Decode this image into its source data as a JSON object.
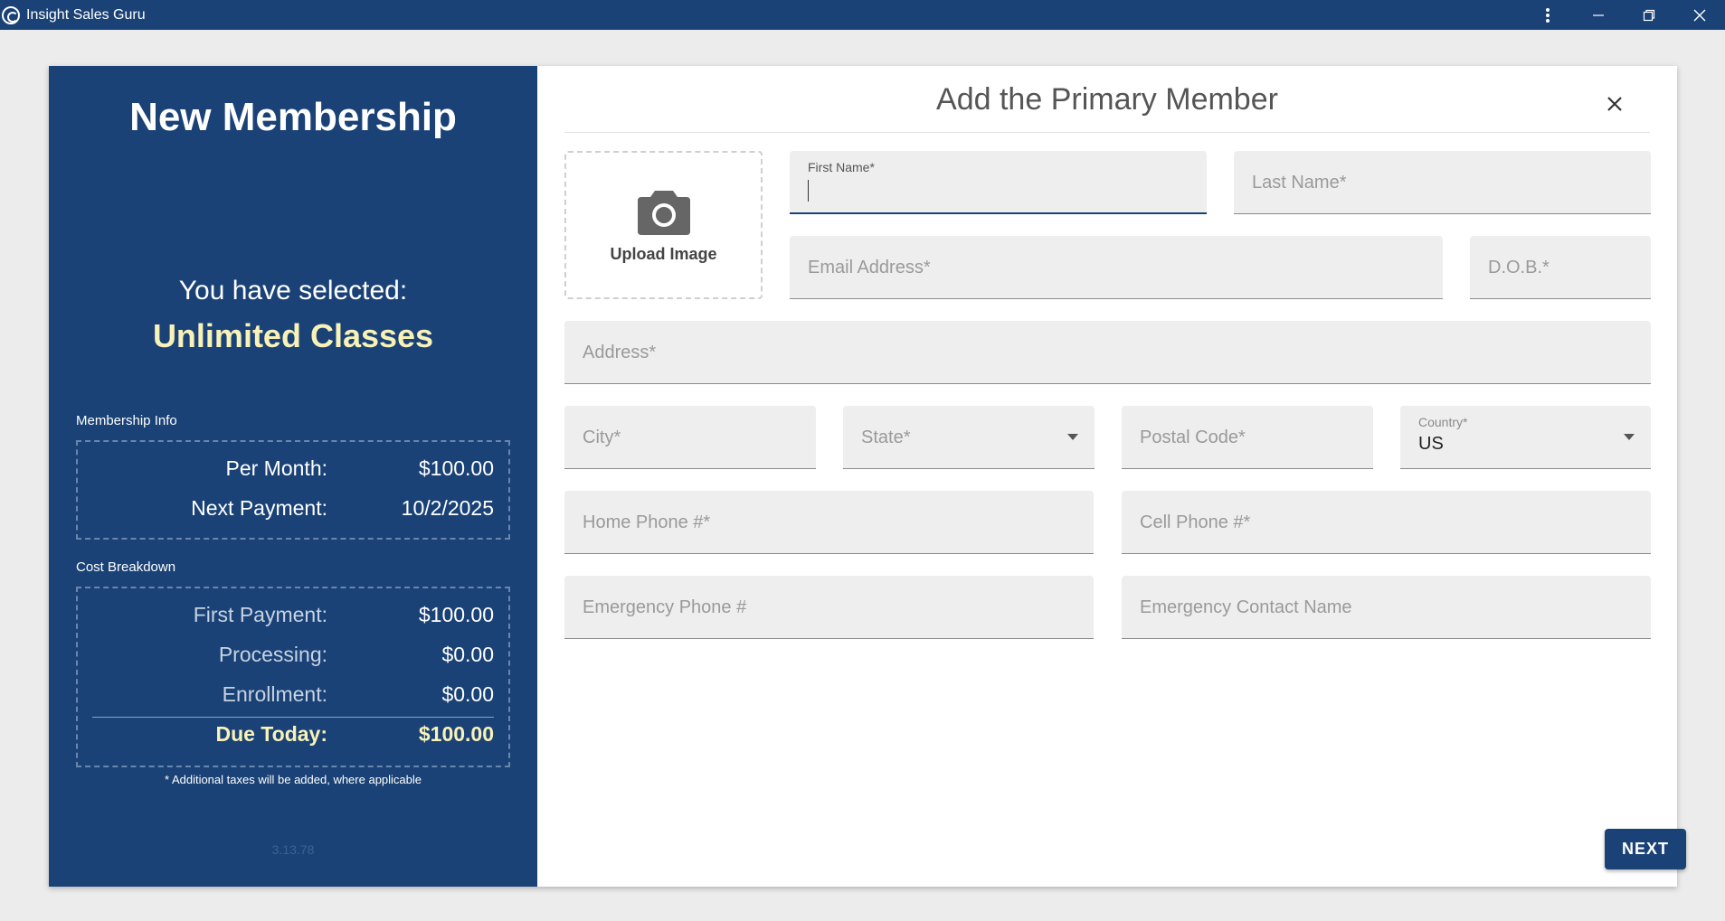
{
  "window": {
    "title": "Insight Sales Guru"
  },
  "summary": {
    "heading": "New Membership",
    "selected_label": "You have selected:",
    "selected_plan": "Unlimited Classes",
    "membership_info_label": "Membership Info",
    "membership_info": [
      {
        "label": "Per Month:",
        "value": "$100.00"
      },
      {
        "label": "Next Payment:",
        "value": "10/2/2025"
      }
    ],
    "cost_breakdown_label": "Cost Breakdown",
    "cost_breakdown": [
      {
        "label": "First Payment:",
        "value": "$100.00"
      },
      {
        "label": "Processing:",
        "value": "$0.00"
      },
      {
        "label": "Enrollment:",
        "value": "$0.00"
      }
    ],
    "due_today": {
      "label": "Due Today:",
      "value": "$100.00"
    },
    "tax_note": "* Additional taxes will be added, where applicable",
    "version": "3.13.78"
  },
  "form": {
    "title": "Add the Primary Member",
    "upload_label": "Upload Image",
    "first_name_label": "First Name*",
    "last_name_label": "Last Name*",
    "email_label": "Email Address*",
    "dob_label": "D.O.B.*",
    "address_label": "Address*",
    "city_label": "City*",
    "state_label": "State*",
    "postal_label": "Postal Code*",
    "country_label": "Country*",
    "country_value": "US",
    "home_phone_label": "Home Phone #*",
    "cell_phone_label": "Cell Phone #*",
    "emergency_phone_label": "Emergency Phone #",
    "emergency_contact_label": "Emergency Contact Name",
    "next_label": "NEXT"
  }
}
